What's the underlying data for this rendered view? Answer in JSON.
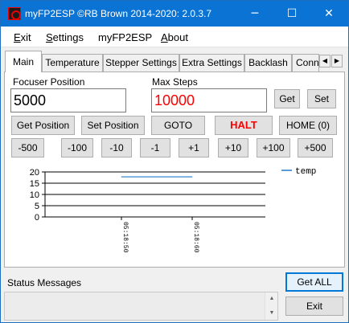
{
  "window": {
    "title": "myFP2ESP ©RB Brown 2014-2020: 2.0.3.7",
    "minimize_glyph": "─",
    "maximize_glyph": "☐",
    "close_glyph": "✕"
  },
  "menu": {
    "exit": {
      "u": "E",
      "rest": "xit"
    },
    "settings": {
      "u": "S",
      "rest": "ettings"
    },
    "myfp2esp": "myFP2ESP",
    "about": {
      "u": "A",
      "rest": "bout"
    }
  },
  "tabs": [
    {
      "label": "Main",
      "active": true
    },
    {
      "label": "Temperature"
    },
    {
      "label": "Stepper Settings"
    },
    {
      "label": "Extra Settings"
    },
    {
      "label": "Backlash"
    },
    {
      "label": "Conn"
    }
  ],
  "tab_scroll": {
    "left": "◀",
    "right": "▶"
  },
  "main": {
    "focuser_position_label": "Focuser Position",
    "focuser_position_value": "5000",
    "max_steps_label": "Max Steps",
    "max_steps_value": "10000",
    "max_steps_color": "#ff0000",
    "get_label": "Get",
    "set_label": "Set",
    "get_position_label": "Get Position",
    "set_position_label": "Set Position",
    "goto_label": "GOTO",
    "halt_label": "HALT",
    "home_label": "HOME (0)",
    "step_buttons": [
      "-500",
      "-100",
      "-10",
      "-1",
      "+1",
      "+10",
      "+100",
      "+500"
    ]
  },
  "chart_data": {
    "type": "line",
    "title": "",
    "xlabel": "",
    "ylabel": "",
    "ylim": [
      0,
      20
    ],
    "y_ticks": [
      "20",
      "15",
      "10",
      "5",
      "0"
    ],
    "x_tick_labels": [
      "05:18:50",
      "05:18:60"
    ],
    "grid": true,
    "legend_position": "top-right",
    "series": [
      {
        "name": "temp",
        "color": "#5b9bd5",
        "x": [
          "05:18:50",
          "05:18:60"
        ],
        "y": [
          17.8,
          17.8
        ]
      }
    ]
  },
  "status": {
    "label": "Status Messages",
    "scroll_up": "▲",
    "scroll_down": "▼"
  },
  "buttons": {
    "get_all": "Get ALL",
    "exit": "Exit"
  }
}
